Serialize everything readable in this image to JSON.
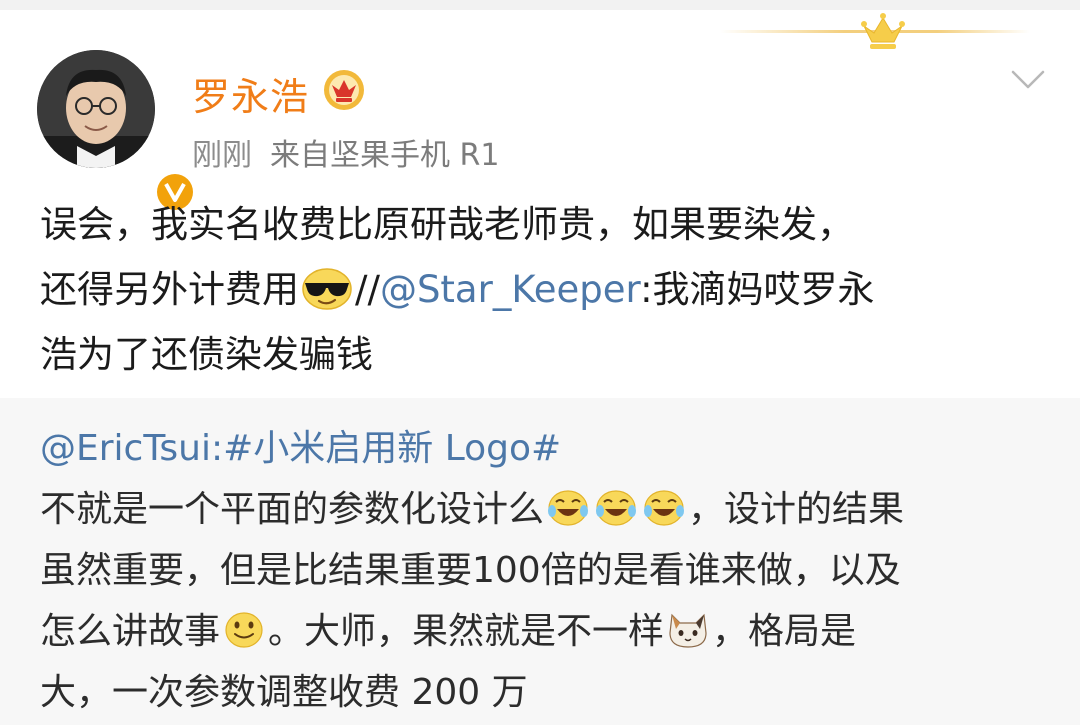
{
  "post": {
    "username": "罗永浩",
    "time": "刚刚",
    "source": "来自坚果手机 R1",
    "text_line1": "误会，我实名收费比原研哉老师贵，如果要染发，",
    "text_line2_before": "还得另外计费用",
    "text_line2_sep": "//",
    "text_mention": "@Star_Keeper",
    "text_line2_after": ":我滴妈哎罗永",
    "text_line3": "浩为了还债染发骗钱"
  },
  "quote": {
    "mention": "@EricTsui",
    "topic": ":#小米启用新 Logo#",
    "line1_before": "不就是一个平面的参数化设计么",
    "line1_after": "，设计的结果",
    "line2": "虽然重要，但是比结果重要100倍的是看谁来做，以及",
    "line3_before": "怎么讲故事",
    "line3_mid": "。大师，果然就是不一样",
    "line3_after": "，格局是",
    "line4": "大，一次参数调整收费 200 万"
  },
  "icons": {
    "verified": "verified-v-badge-icon",
    "vip": "vip-crown-icon",
    "more": "chevron-down-icon",
    "cool": "sunglasses-emoji-icon",
    "laugh": "laugh-tears-emoji-icon",
    "smile": "smile-emoji-icon",
    "cat": "cat-face-emoji-icon"
  },
  "colors": {
    "username": "#f07d18",
    "mention": "#4c77a8",
    "meta": "#8c8c8c",
    "quote_bg": "#f7f7f7",
    "vip_gold": "#f2b93a"
  }
}
